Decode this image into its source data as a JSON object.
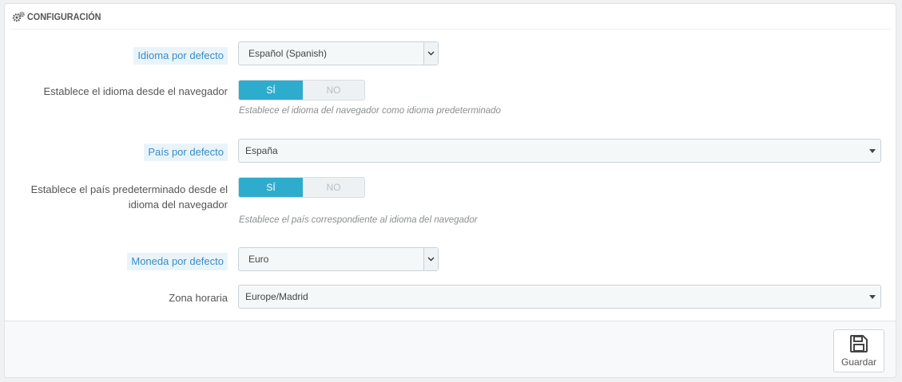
{
  "panel": {
    "heading": "CONFIGURACIÓN",
    "heading_icon": "cogs-icon"
  },
  "fields": {
    "language": {
      "label": "Idioma por defecto",
      "value": "Español (Spanish)"
    },
    "browser_language": {
      "label": "Establece el idioma desde el navegador",
      "on_label": "SÍ",
      "off_label": "NO",
      "selected": "SÍ",
      "help": "Establece el idioma del navegador como idioma predeterminado"
    },
    "country": {
      "label": "País por defecto",
      "value": "España"
    },
    "browser_country": {
      "label_line1": "Establece el país predeterminado desde el",
      "label_line2": "idioma del navegador",
      "on_label": "SÍ",
      "off_label": "NO",
      "selected": "SÍ",
      "help": "Establece el país correspondiente al idioma del navegador"
    },
    "currency": {
      "label": "Moneda por defecto",
      "value": "Euro"
    },
    "timezone": {
      "label": "Zona horaria",
      "value": "Europe/Madrid"
    }
  },
  "footer": {
    "save_label": "Guardar",
    "save_icon": "floppy-disk-icon"
  },
  "colors": {
    "switch_active": "#2eacce",
    "label_highlight_bg": "#e9f4fa",
    "label_highlight_text": "#3a8cc4"
  }
}
